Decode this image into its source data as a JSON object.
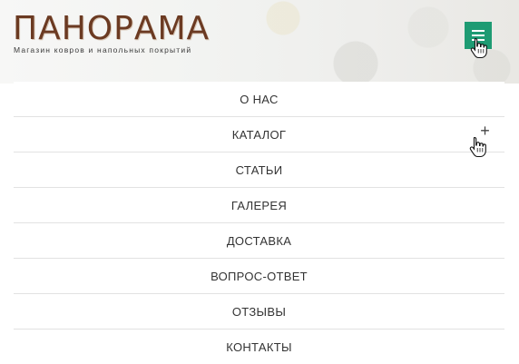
{
  "header": {
    "logo_title": "ПАНОРАМА",
    "logo_subtitle": "Магазин ковров и напольных покрытий",
    "menu_button_icon": "hamburger-icon",
    "accent_color": "#1e9b73"
  },
  "menu": {
    "items": [
      {
        "label": "О НАС"
      },
      {
        "label": "КАТАЛОГ",
        "expand_symbol": "+"
      },
      {
        "label": "СТАТЬИ"
      },
      {
        "label": "ГАЛЕРЕЯ"
      },
      {
        "label": "ДОСТАВКА"
      },
      {
        "label": "ВОПРОС-ОТВЕТ"
      },
      {
        "label": "ОТЗЫВЫ"
      },
      {
        "label": "КОНТАКТЫ"
      }
    ]
  }
}
